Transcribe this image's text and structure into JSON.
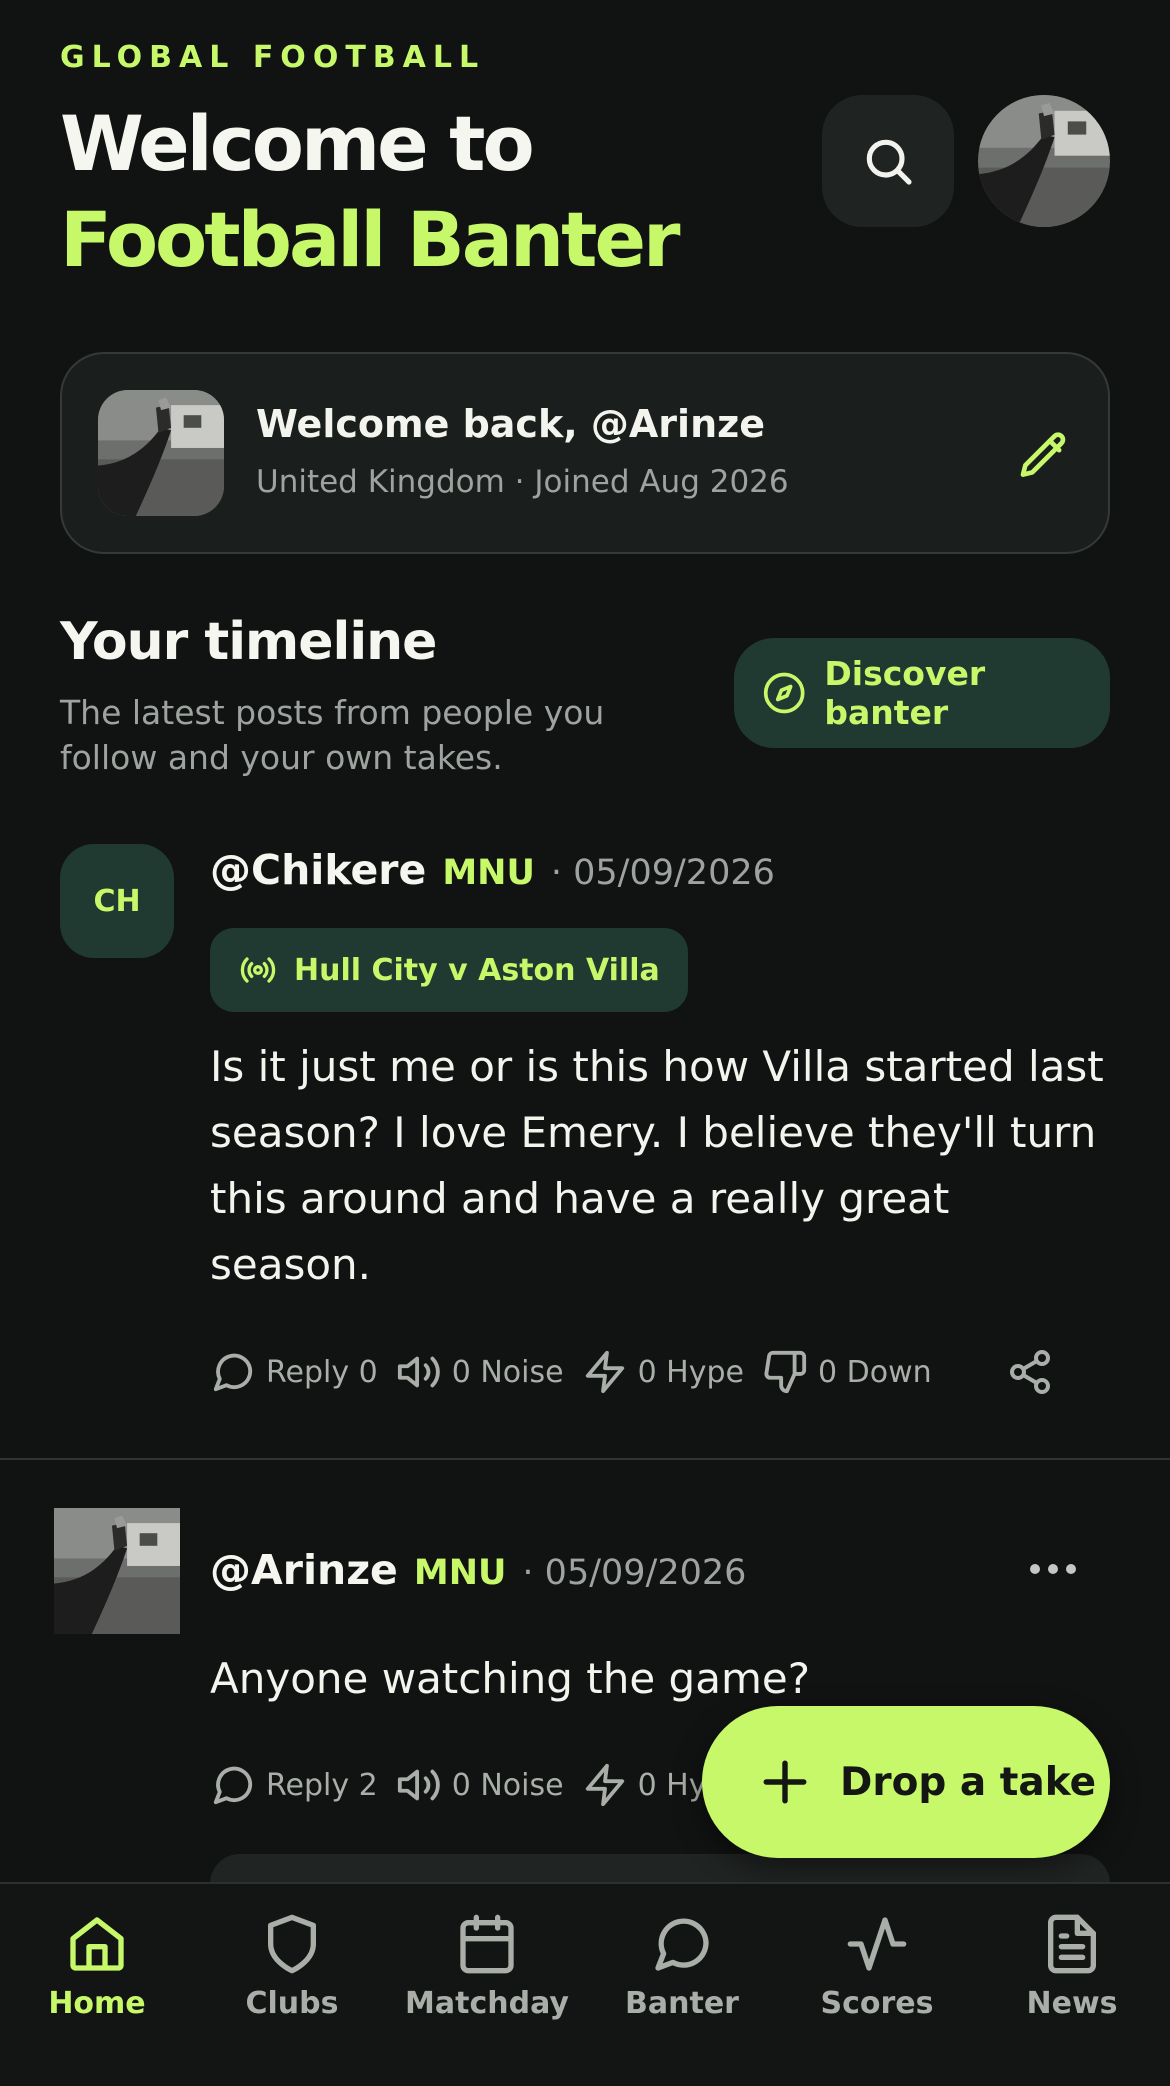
{
  "header": {
    "eyebrow": "GLOBAL FOOTBALL",
    "title_line1": "Welcome to",
    "title_line2": "Football Banter",
    "search_icon": "search-icon"
  },
  "welcome_card": {
    "greeting": "Welcome back, @Arinze",
    "subtitle": "United Kingdom · Joined Aug 2026",
    "edit_icon": "pencil-icon"
  },
  "timeline": {
    "title": "Your timeline",
    "subtitle": "The latest posts from people you follow and your own takes.",
    "discover_label": "Discover banter"
  },
  "posts": [
    {
      "avatar_initials": "CH",
      "handle": "@Chikere",
      "club": "MNU",
      "date": "· 05/09/2026",
      "match": "Hull City v Aston Villa",
      "body": "Is it just me or is this how Villa started last season? I love Emery. I believe they'll turn this around and have a really great season.",
      "actions": {
        "reply": "Reply 0",
        "noise": "0 Noise",
        "hype": "0 Hype",
        "down": "0 Down"
      }
    },
    {
      "handle": "@Arinze",
      "club": "MNU",
      "date": "· 05/09/2026",
      "body": "Anyone watching the game?",
      "actions": {
        "reply": "Reply 2",
        "noise": "0 Noise",
        "hype": "0 Hy"
      }
    }
  ],
  "fab": {
    "label": "Drop a take"
  },
  "nav": {
    "items": [
      {
        "label": "Home",
        "icon": "home-icon",
        "active": true
      },
      {
        "label": "Clubs",
        "icon": "shield-icon",
        "active": false
      },
      {
        "label": "Matchday",
        "icon": "calendar-icon",
        "active": false
      },
      {
        "label": "Banter",
        "icon": "chat-icon",
        "active": false
      },
      {
        "label": "Scores",
        "icon": "activity-icon",
        "active": false
      },
      {
        "label": "News",
        "icon": "document-icon",
        "active": false
      }
    ]
  },
  "colors": {
    "accent": "#c6f86a",
    "background": "#111312",
    "card": "#1a1e1c",
    "pill": "#213a31",
    "muted_text": "#9ea39f"
  }
}
